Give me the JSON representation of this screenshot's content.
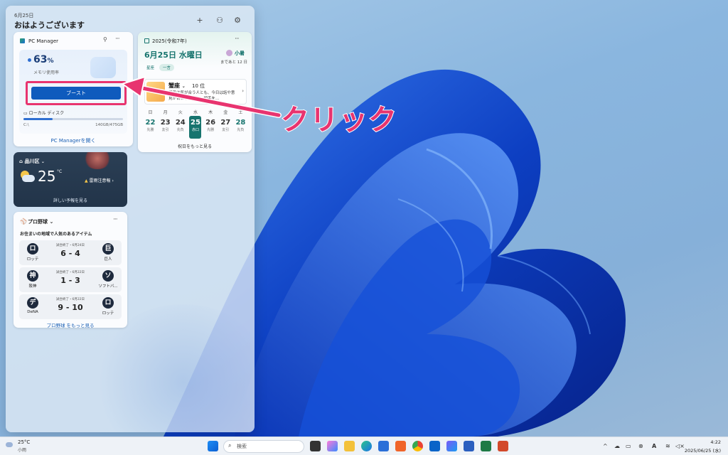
{
  "panel": {
    "date": "6月25日",
    "greeting": "おはようございます"
  },
  "pc_manager": {
    "title": "PC Manager",
    "memory_percent": "63",
    "percent_sign": "%",
    "memory_label": "メモリ使用率",
    "boost_label": "ブースト",
    "disk_label": "ローカル ディスク",
    "disk_drive": "C:\\",
    "disk_usage": "140GB/475GB",
    "disk_fill": 0.29,
    "open_link": "PC Managerを開く"
  },
  "calendar": {
    "header": "2025(令和7年)",
    "big_date": "6月25日 水曜日",
    "season": "小暑",
    "until": "まであと 12 日",
    "tag1": "星座",
    "tag2": "一言",
    "sign": "蟹座",
    "rank": "10 位",
    "fortune": "普段は気が合う人とも、今日は話や意見が合わないかも。相手を…",
    "days": [
      "日",
      "月",
      "火",
      "水",
      "木",
      "金",
      "土"
    ],
    "nums": [
      {
        "n": "22",
        "r": "先勝"
      },
      {
        "n": "23",
        "r": "友引"
      },
      {
        "n": "24",
        "r": "先負"
      },
      {
        "n": "25",
        "r": "赤口"
      },
      {
        "n": "26",
        "r": "先勝"
      },
      {
        "n": "27",
        "r": "友引"
      },
      {
        "n": "28",
        "r": "先負"
      }
    ],
    "link": "祝日をもっと見る"
  },
  "weather": {
    "location": "品川区",
    "temp": "25",
    "unit": "°C",
    "alert": "雷雨注意報",
    "link": "詳しい予報を見る"
  },
  "baseball": {
    "title": "プロ野球",
    "subtitle": "お住まいの地域で人気のあるアイテム",
    "matches": [
      {
        "t1": "ロ",
        "n1": "ロッテ",
        "status": "試合終了・6月24日",
        "score": "6 - 4",
        "t2": "巨",
        "n2": "巨人"
      },
      {
        "t1": "神",
        "n1": "阪神",
        "status": "試合終了・6月22日",
        "score": "1 - 3",
        "t2": "ソ",
        "n2": "ソフトバ..."
      },
      {
        "t1": "デ",
        "n1": "DeNA",
        "status": "試合終了・6月22日",
        "score": "9 - 10",
        "t2": "ロ",
        "n2": "ロッテ"
      }
    ],
    "link": "プロ野球 をもっと見る"
  },
  "annotation": {
    "label": "クリック",
    "color": "#e8346f"
  },
  "taskbar": {
    "weather_temp": "25°C",
    "weather_desc": "小雨",
    "search_placeholder": "検索",
    "time": "4:22",
    "date": "2025/06/25 (水)"
  }
}
